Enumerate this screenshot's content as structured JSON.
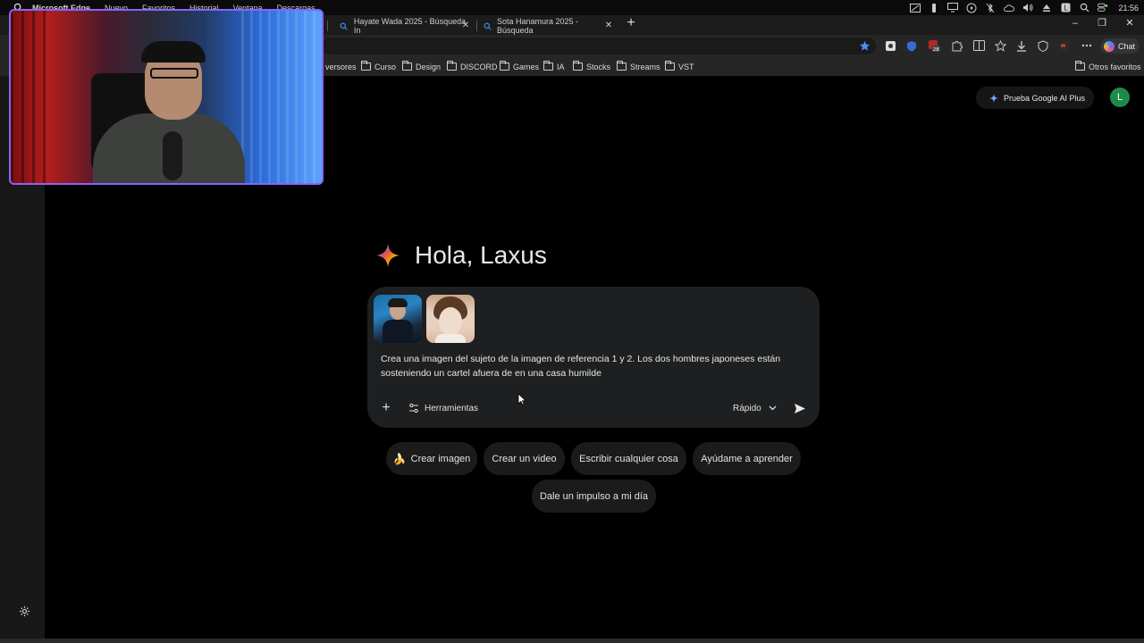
{
  "menubar": {
    "app_name": "Microsoft Edge",
    "items": [
      "Nuevo",
      "Favoritos",
      "Historial",
      "Ventana",
      "Descargas"
    ],
    "clock": "21:56"
  },
  "tabs": [
    {
      "title": "Hayate Wada 2025 - Búsqueda In"
    },
    {
      "title": "Sota Hanamura 2025 - Búsqueda"
    }
  ],
  "toolbar": {
    "chat_label": "Chat",
    "extension_badge": "28"
  },
  "bookmarks": {
    "items": [
      "versores",
      "Curso",
      "Design",
      "DISCORD",
      "Games",
      "IA",
      "Stocks",
      "Streams",
      "VST"
    ],
    "other": "Otros favoritos"
  },
  "header": {
    "upgrade_label": "Prueba Google AI Plus",
    "avatar_letter": "L"
  },
  "greeting": {
    "text": "Hola, Laxus"
  },
  "prompt": {
    "text": "Crea una imagen del sujeto de la imagen de referencia 1 y 2. Los dos hombres japoneses están sosteniendo un cartel afuera de en una casa humilde",
    "tools_label": "Herramientas",
    "mode_label": "Rápido"
  },
  "chips": [
    {
      "emoji": "🍌",
      "label": "Crear imagen"
    },
    {
      "emoji": "",
      "label": "Crear un video"
    },
    {
      "emoji": "",
      "label": "Escribir cualquier cosa"
    },
    {
      "emoji": "",
      "label": "Ayúdame a aprender"
    },
    {
      "emoji": "",
      "label": "Dale un impulso a mi día"
    }
  ],
  "colors": {
    "accent_green": "#1e8a4a",
    "webcam_border": "#8a63ff",
    "card_bg": "#1e1f20"
  }
}
